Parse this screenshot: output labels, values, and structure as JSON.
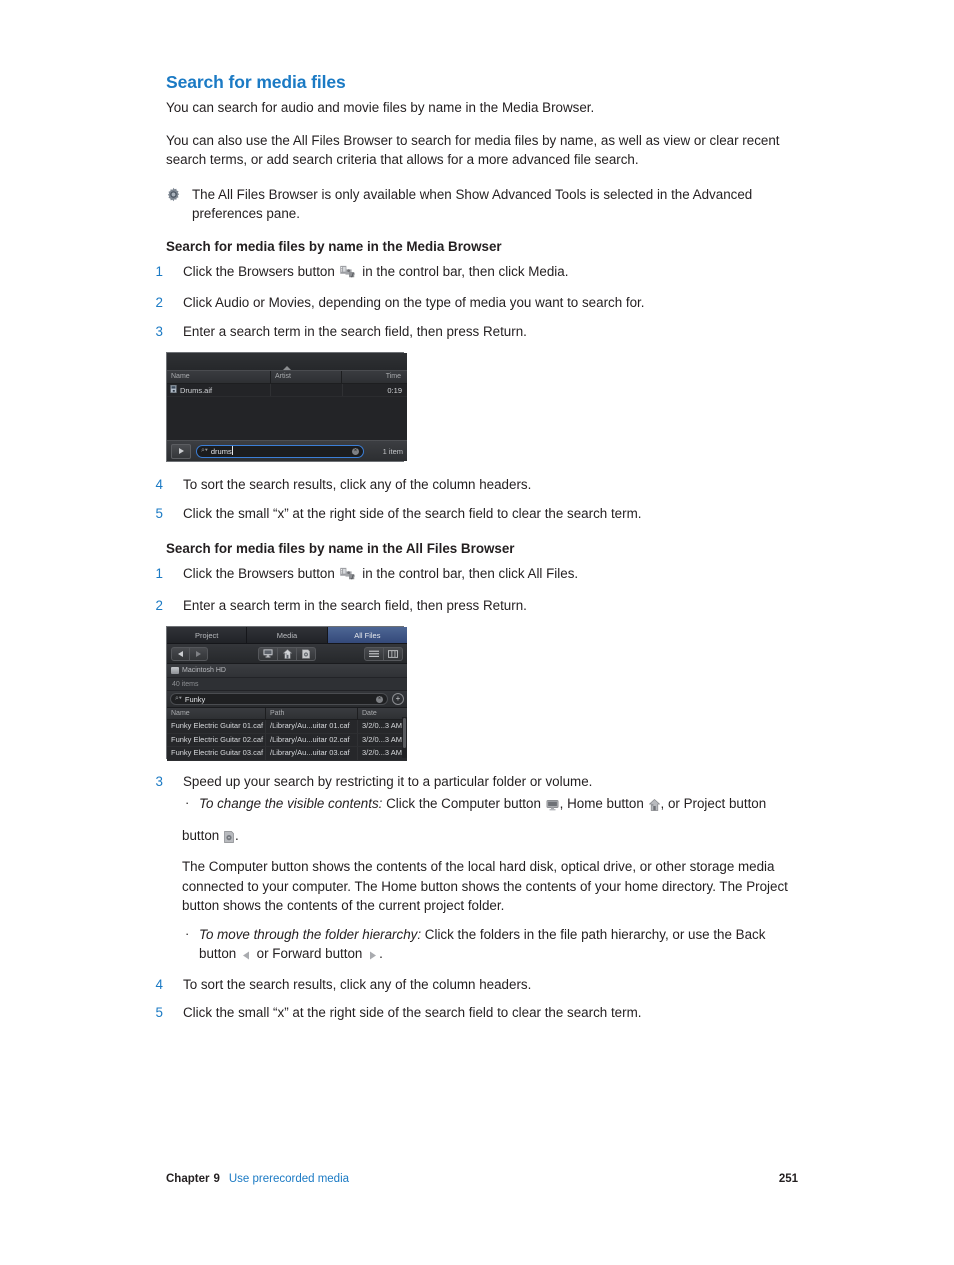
{
  "section": {
    "title": "Search for media files",
    "intro": "You can search for audio and movie files by name in the Media Browser.",
    "paragraph2": "You can also use the All Files Browser to search for media files by name, as well as view or clear recent search terms, or add search criteria that allows for a more advanced file search.",
    "note": "The All Files Browser is only available when Show Advanced Tools is selected in the Advanced preferences pane.",
    "note_icon": "gear-icon"
  },
  "media_browser_proc": {
    "heading": "Search for media files by name in the Media Browser",
    "steps": [
      {
        "num": "1",
        "pre": "Click the Browsers button ",
        "icon": "browsers-icon",
        "post": " in the control bar, then click Media."
      },
      {
        "num": "2",
        "pre": "Click Audio or Movies, depending on the type of media you want to search for.",
        "post": ""
      },
      {
        "num": "3",
        "pre": "Enter a search term in the search field, then press Return.",
        "post": ""
      },
      {
        "num": "4",
        "pre": "To sort the search results, click any of the column headers.",
        "post": ""
      },
      {
        "num": "5",
        "pre": "Click the small “x” at the right side of the search field to clear the search term.",
        "post": ""
      }
    ]
  },
  "media_browser_figure": {
    "columns": [
      "Name",
      "Artist",
      "Time"
    ],
    "rows": [
      {
        "name": "Drums.aif",
        "artist": "",
        "time": "0:19",
        "icon": "audio-file-icon"
      }
    ],
    "play_button": "play-icon",
    "search_value": "drums",
    "search_icon": "search-magnifier-icon",
    "clear_icon": "clear-x-icon",
    "item_count": "1 item",
    "selected_border_color": "#3b7ed6"
  },
  "all_files_proc": {
    "heading": "Search for media files by name in the All Files Browser",
    "steps": [
      {
        "num": "1",
        "pre": "Click the Browsers button ",
        "icon": "browsers-icon",
        "post": " in the control bar, then click All Files."
      },
      {
        "num": "2",
        "pre": "Enter a search term in the search field, then press Return.",
        "post": ""
      }
    ],
    "step3": {
      "num": "3",
      "text": "Speed up your search by restricting it to a particular folder or volume."
    },
    "bullet1": {
      "emphasis": "To change the visible contents:",
      "part1": " Click the Computer button ",
      "icon1": "computer-monitor-icon",
      "part2": ", Home button ",
      "icon2": "home-house-icon",
      "part3": ", or Project button ",
      "icon3": "project-disc-icon",
      "part4": "."
    },
    "bullet1_para": "The Computer button shows the contents of the local hard disk, optical drive, or other storage media connected to your computer. The Home button shows the contents of your home directory. The Project button shows the contents of the current project folder.",
    "bullet2": {
      "emphasis": "To move through the folder hierarchy:",
      "part1": " Click the folders in the file path hierarchy, or use the Back button ",
      "icon1": "back-arrow-icon",
      "part2": " or Forward button ",
      "icon2": "forward-arrow-icon",
      "part3": "."
    },
    "step4": {
      "num": "4",
      "text": "To sort the search results, click any of the column headers."
    },
    "step5": {
      "num": "5",
      "text": "Click the small “x” at the right side of the search field to clear the search term."
    }
  },
  "all_files_figure": {
    "tabs": [
      {
        "label": "Project",
        "active": false
      },
      {
        "label": "Media",
        "active": false
      },
      {
        "label": "All Files",
        "active": true
      }
    ],
    "active_tab_color": "#3d5485",
    "nav": {
      "back": "back-arrow-icon",
      "forward": "forward-arrow-icon"
    },
    "locations": [
      "computer-monitor-icon",
      "home-house-icon",
      "project-disc-icon"
    ],
    "views": [
      "list-view-icon",
      "column-view-icon"
    ],
    "path_label": "Macintosh HD",
    "path_icon": "hard-disk-icon",
    "item_count": "40 items",
    "search_value": "Funky",
    "search_icon": "search-magnifier-icon",
    "clear_icon": "clear-x-icon",
    "add_criteria_icon": "add-criteria-icon",
    "columns": [
      "Name",
      "Path",
      "Date"
    ],
    "rows": [
      {
        "name": "Funky Electric Guitar 01.caf",
        "path": "/Library/Au...uitar 01.caf",
        "date": "3/2/0...3 AM"
      },
      {
        "name": "Funky Electric Guitar 02.caf",
        "path": "/Library/Au...uitar 02.caf",
        "date": "3/2/0...3 AM"
      },
      {
        "name": "Funky Electric Guitar 03.caf",
        "path": "/Library/Au...uitar 03.caf",
        "date": "3/2/0...3 AM"
      }
    ]
  },
  "footer": {
    "chapter_label": "Chapter",
    "chapter_number": "9",
    "chapter_title": "Use prerecorded media",
    "page_number": "251",
    "link_color": "#1b7ac4"
  }
}
